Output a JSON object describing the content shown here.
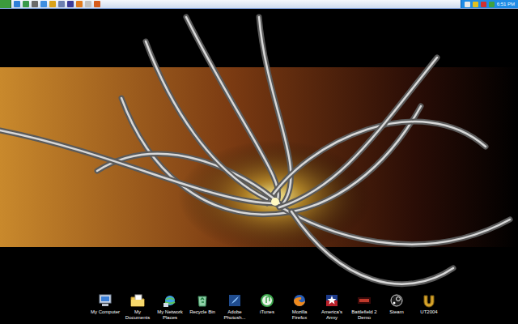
{
  "taskbar": {
    "clock": "6:51 PM"
  },
  "desktop_icons": [
    {
      "label": "My Computer"
    },
    {
      "label": "My Documents"
    },
    {
      "label": "My Network Places"
    },
    {
      "label": "Recycle Bin"
    },
    {
      "label": "Adobe Photosh..."
    },
    {
      "label": "iTunes"
    },
    {
      "label": "Mozilla Firefox"
    },
    {
      "label": "America's Army"
    },
    {
      "label": "Battlefield 2 Demo"
    },
    {
      "label": "Steam"
    },
    {
      "label": "UT2004"
    }
  ]
}
